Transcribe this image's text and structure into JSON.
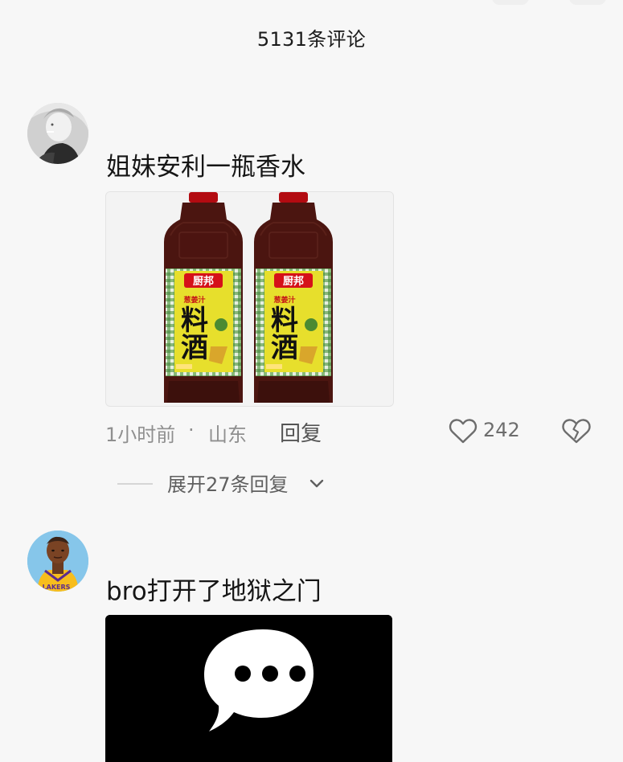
{
  "header": {
    "title": "5131条评论"
  },
  "comments": [
    {
      "text": "姐妹安利一瓶香水",
      "time": "1小时前",
      "dot": "·",
      "location": "山东",
      "reply_label": "回复",
      "likes": "242",
      "expand_label": "展开27条回复",
      "image": {
        "brand": "厨邦",
        "line1": "葱姜汁",
        "line2": "料",
        "line3": "酒"
      }
    },
    {
      "text": "bro打开了地狱之门",
      "avatar_label": "LAKERS"
    }
  ],
  "colors": {
    "background": "#f7f7f7",
    "meta_text": "#8f8f8f",
    "text": "#161616"
  },
  "icons": {
    "like": "heart-outline-icon",
    "dislike": "broken-heart-icon",
    "expand": "chevron-down-icon"
  }
}
